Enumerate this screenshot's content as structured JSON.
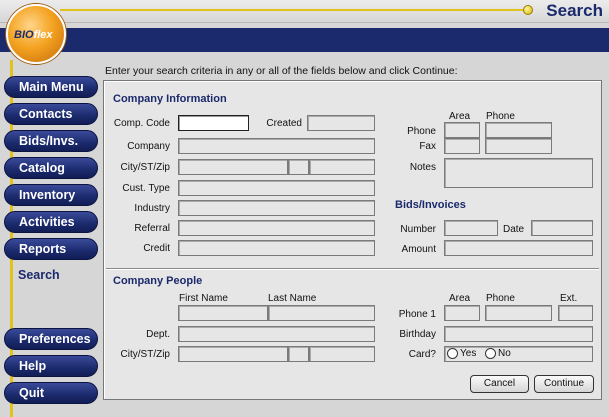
{
  "header": {
    "title": "Search",
    "logo_text": "BIO",
    "logo_text_accent": "flex"
  },
  "sidebar": {
    "items": [
      {
        "label": "Main Menu"
      },
      {
        "label": "Contacts"
      },
      {
        "label": "Bids/Invs."
      },
      {
        "label": "Catalog"
      },
      {
        "label": "Inventory"
      },
      {
        "label": "Activities"
      },
      {
        "label": "Reports"
      }
    ],
    "current": "Search",
    "bottom_items": [
      {
        "label": "Preferences"
      },
      {
        "label": "Help"
      },
      {
        "label": "Quit"
      }
    ]
  },
  "instruction": "Enter your search criteria in any or all of the fields below and click Continue:",
  "company_info": {
    "title": "Company Information",
    "comp_code": "Comp. Code",
    "created": "Created",
    "company": "Company",
    "city_st_zip": "City/ST/Zip",
    "cust_type": "Cust. Type",
    "industry": "Industry",
    "referral": "Referral",
    "credit": "Credit",
    "area_header": "Area",
    "phone_header": "Phone",
    "phone": "Phone",
    "fax": "Fax",
    "notes": "Notes"
  },
  "bids": {
    "title": "Bids/Invoices",
    "number": "Number",
    "date": "Date",
    "amount": "Amount"
  },
  "company_people": {
    "title": "Company People",
    "first_name_header": "First Name",
    "last_name_header": "Last Name",
    "dept": "Dept.",
    "city_st_zip": "City/ST/Zip",
    "area_header": "Area",
    "phone_header": "Phone",
    "ext_header": "Ext.",
    "phone1": "Phone 1",
    "birthday": "Birthday",
    "card": "Card?",
    "card_yes": "Yes",
    "card_no": "No"
  },
  "buttons": {
    "cancel": "Cancel",
    "continue": "Continue"
  },
  "colors": {
    "navy": "#1b2a6c",
    "gold": "#e3c21a",
    "logo_orange": "#f4a321"
  }
}
